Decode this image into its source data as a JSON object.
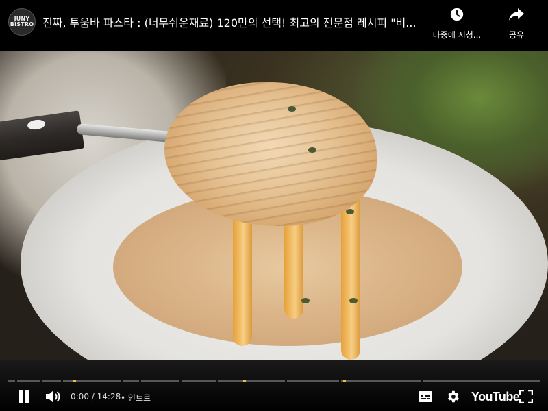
{
  "channel": {
    "avatar_text_line1": "JUNY",
    "avatar_text_line2": "BISTRO"
  },
  "video": {
    "title": "진짜, 투움바 파스타 : (너무쉬운재료) 120만의 선택! 최고의 전문점 레시피 \"비..."
  },
  "top_actions": {
    "watch_later_label": "나중에 시청...",
    "share_label": "공유",
    "watch_later_icon": "clock-icon",
    "share_icon": "share-arrow-icon"
  },
  "player": {
    "current_time": "0:00",
    "time_separator": " / ",
    "duration": "14:28",
    "chapter_prefix": "•",
    "chapter_title": "인트로",
    "progress_fraction": 0.0,
    "logo_text": "YouTube",
    "accent_color": "#ff0000",
    "chapter_marker_color": "#f1c232",
    "icons": [
      "pause-icon",
      "volume-icon",
      "subtitles-icon",
      "settings-gear-icon",
      "fullscreen-icon"
    ]
  }
}
